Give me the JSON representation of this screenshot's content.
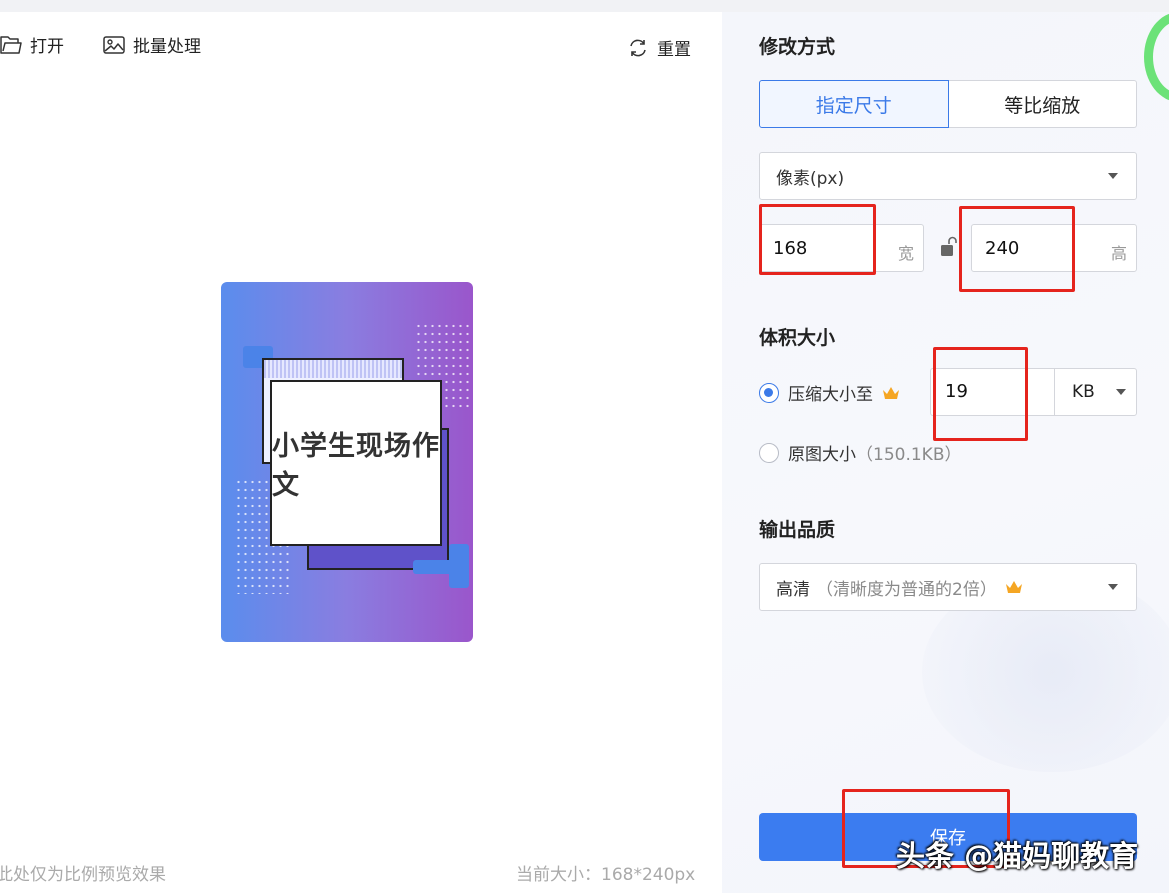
{
  "toolbar": {
    "open_label": "打开",
    "batch_label": "批量处理",
    "reset_label": "重置"
  },
  "preview": {
    "image_text": "小学生现场作文",
    "note": "此处仅为比例预览效果",
    "current_size": "当前大小：168*240px"
  },
  "settings": {
    "mode": {
      "title": "修改方式",
      "options": [
        "指定尺寸",
        "等比缩放"
      ],
      "selected": "指定尺寸"
    },
    "unit_select": {
      "value": "像素(px)"
    },
    "width": {
      "value": "168",
      "suffix": "宽"
    },
    "height": {
      "value": "240",
      "suffix": "高"
    },
    "volume": {
      "title": "体积大小",
      "compress_label": "压缩大小至",
      "compress_value": "19",
      "compress_unit": "KB",
      "original_label": "原图大小",
      "original_size": "（150.1KB）",
      "selected": "compress"
    },
    "quality": {
      "title": "输出品质",
      "value": "高清",
      "hint": "（清晰度为普通的2倍）"
    },
    "save_label": "保存"
  },
  "watermark": "头条 @猫妈聊教育",
  "colors": {
    "accent": "#3b7ae8",
    "save_button": "#3b7cf0",
    "annotation": "#e5241d",
    "crown": "#f5a623"
  },
  "icons": {
    "open": "folder-icon",
    "batch": "image-icon",
    "reset": "refresh-icon",
    "lock": "unlock-icon",
    "vip": "crown-icon"
  }
}
